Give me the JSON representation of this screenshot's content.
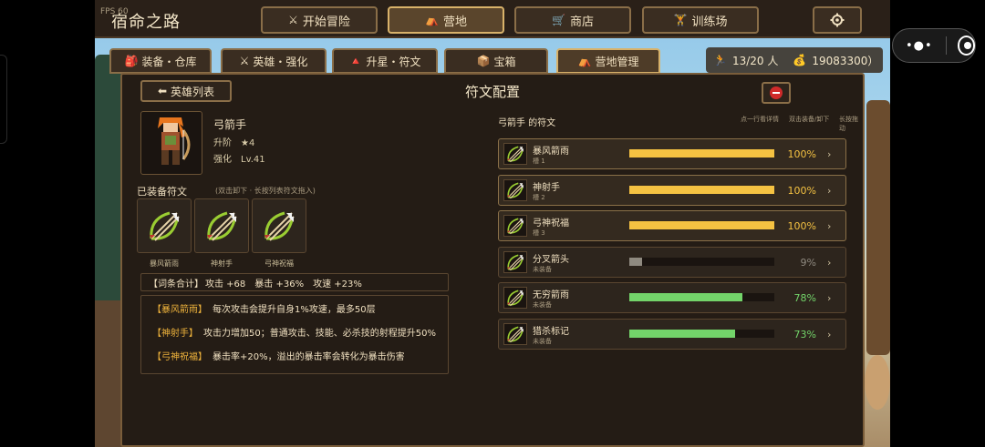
{
  "app": {
    "title": "宿命之路",
    "fps": "FPS 60"
  },
  "top_nav": [
    {
      "label": "开始冒险",
      "icon": "crossed-swords-icon",
      "glyph": "⚔",
      "active": false
    },
    {
      "label": "营地",
      "icon": "camp-icon",
      "glyph": "⛺",
      "active": true
    },
    {
      "label": "商店",
      "icon": "cart-icon",
      "glyph": "🛒",
      "active": false
    },
    {
      "label": "训练场",
      "icon": "dumbbell-icon",
      "glyph": "🏋",
      "active": false
    }
  ],
  "settings_icon": "gear-icon",
  "sub_tabs": [
    {
      "label": "装备・仓库",
      "icon": "backpack-icon",
      "glyph": "🎒",
      "active": false
    },
    {
      "label": "英雄・强化",
      "icon": "crossed-swords-icon",
      "glyph": "⚔",
      "active": false
    },
    {
      "label": "升星・符文",
      "icon": "rune-icon",
      "glyph": "🔺",
      "active": false
    },
    {
      "label": "宝箱",
      "icon": "chest-icon",
      "glyph": "📦",
      "active": false
    },
    {
      "label": "营地管理",
      "icon": "camp-icon",
      "glyph": "⛺",
      "active": true
    }
  ],
  "counter": {
    "population": "13/20 人",
    "gold": "19083300）"
  },
  "panel": {
    "back_label": "英雄列表",
    "title": "符文配置"
  },
  "hero": {
    "name": "弓箭手",
    "rank_label": "升阶",
    "rank_value": "★4",
    "enhance_label": "强化",
    "enhance_value": "Lv.41"
  },
  "equipped": {
    "title": "已装备符文",
    "hint": "(双击卸下 · 长按列表符文拖入)",
    "slots": [
      "暴风箭雨",
      "神射手",
      "弓神祝福"
    ]
  },
  "stat_summary": {
    "label": "【词条合计】",
    "items": [
      "攻击 +68",
      "暴击 +36%",
      "攻速 +23%"
    ]
  },
  "descriptions": [
    {
      "name": "【暴风箭雨】",
      "text": "每次攻击会提升自身1%攻速，最多50层"
    },
    {
      "name": "【神射手】",
      "text": "攻击力增加50；普通攻击、技能、必杀技的射程提升50%"
    },
    {
      "name": "【弓神祝福】",
      "text": "暴击率+20%，溢出的暴击率会转化为暴击伤害"
    }
  ],
  "rune_list": {
    "heading": "弓箭手 的符文",
    "hints": [
      "点一行看详情",
      "双击装备/卸下",
      "长按拖动"
    ],
    "rows": [
      {
        "name": "暴风箭雨",
        "sub": "槽 1",
        "percent": "100%",
        "progress": 1.0,
        "equipped": true,
        "color": "#f5c242"
      },
      {
        "name": "神射手",
        "sub": "槽 2",
        "percent": "100%",
        "progress": 1.0,
        "equipped": true,
        "color": "#f5c242"
      },
      {
        "name": "弓神祝福",
        "sub": "槽 3",
        "percent": "100%",
        "progress": 1.0,
        "equipped": true,
        "color": "#f5c242"
      },
      {
        "name": "分叉箭头",
        "sub": "未装备",
        "percent": "9%",
        "progress": 0.09,
        "equipped": false,
        "color": "#8f8a80"
      },
      {
        "name": "无穷箭雨",
        "sub": "未装备",
        "percent": "78%",
        "progress": 0.78,
        "equipped": false,
        "color": "#73d46a"
      },
      {
        "name": "猎杀标记",
        "sub": "未装备",
        "percent": "73%",
        "progress": 0.73,
        "equipped": false,
        "color": "#73d46a"
      }
    ]
  },
  "colors": {
    "gold": "#f5c242",
    "green": "#73d46a",
    "gray": "#8f8a80",
    "accent": "#d8b26a"
  },
  "system": {
    "menu_icon": "more-dots-icon",
    "close_icon": "target-close-icon"
  }
}
